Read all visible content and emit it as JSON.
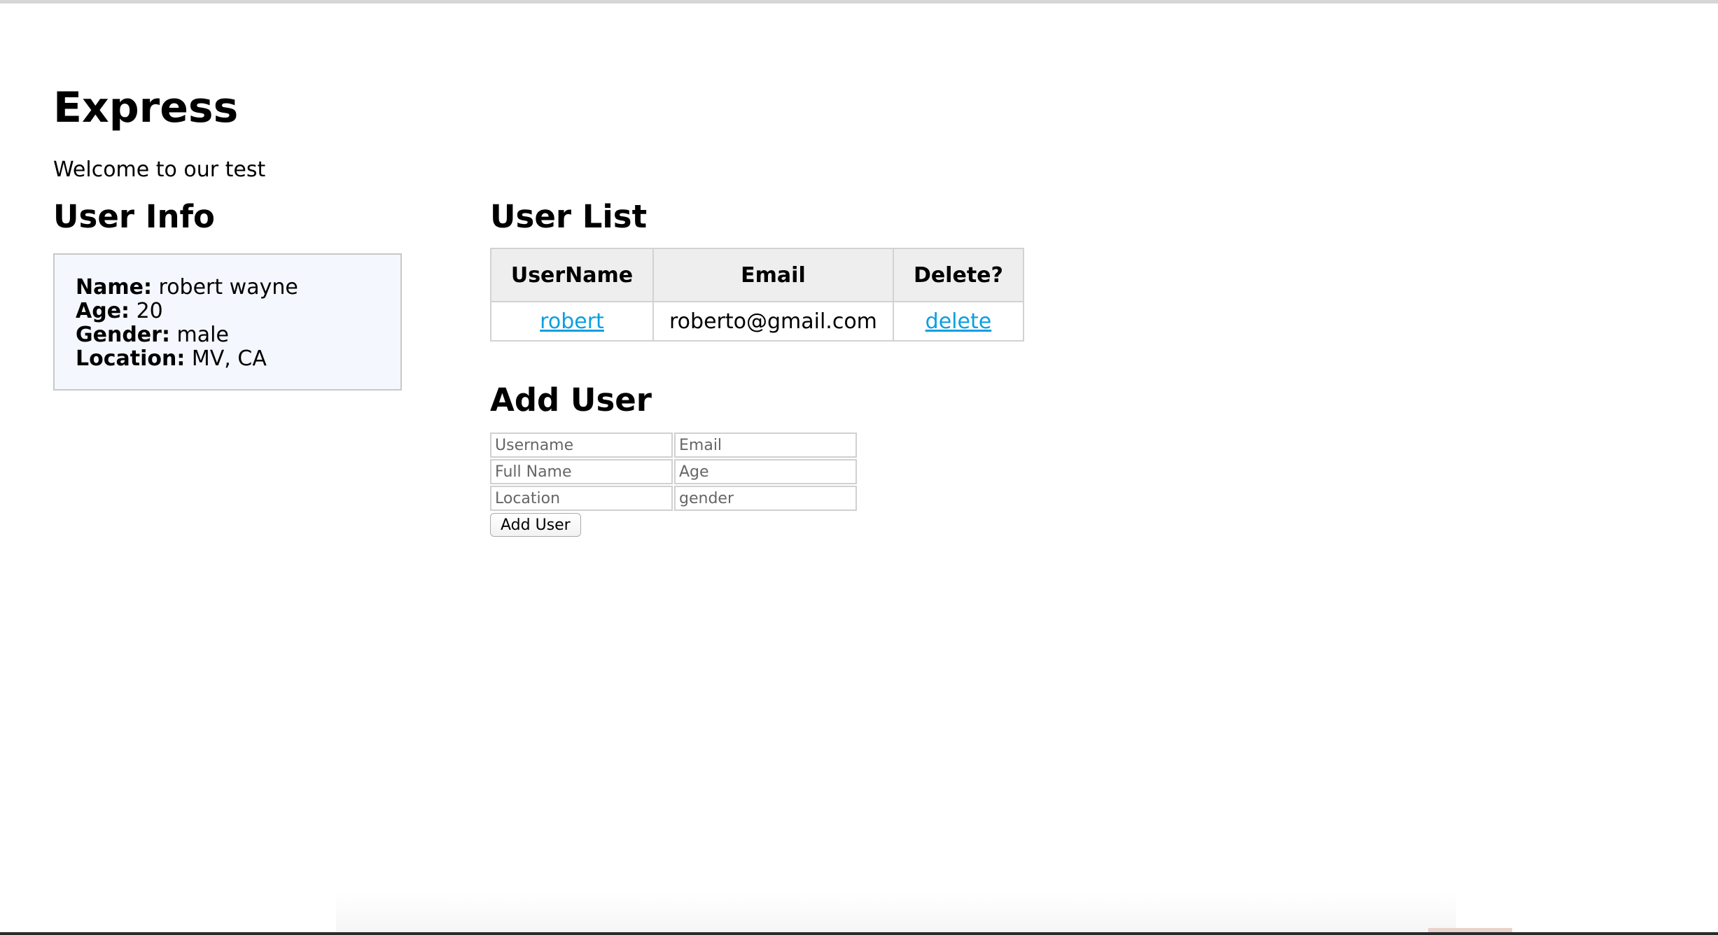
{
  "page": {
    "title": "Express",
    "welcome": "Welcome to our test"
  },
  "user_info": {
    "heading": "User Info",
    "fields": [
      {
        "label": "Name:",
        "value": "robert wayne"
      },
      {
        "label": "Age:",
        "value": "20"
      },
      {
        "label": "Gender:",
        "value": "male"
      },
      {
        "label": "Location:",
        "value": "MV, CA"
      }
    ]
  },
  "user_list": {
    "heading": "User List",
    "columns": [
      "UserName",
      "Email",
      "Delete?"
    ],
    "rows": [
      {
        "username": "robert",
        "email": "roberto@gmail.com",
        "delete_label": "delete"
      }
    ],
    "link_color": "#0b9fe0"
  },
  "add_user": {
    "heading": "Add User",
    "fields": [
      {
        "placeholder": "Username",
        "value": ""
      },
      {
        "placeholder": "Email",
        "value": ""
      },
      {
        "placeholder": "Full Name",
        "value": ""
      },
      {
        "placeholder": "Age",
        "value": ""
      },
      {
        "placeholder": "Location",
        "value": ""
      },
      {
        "placeholder": "gender",
        "value": ""
      }
    ],
    "button_label": "Add User"
  },
  "colors": {
    "info_box_background": "#f4f7fd",
    "table_header_background": "#eeeeee"
  }
}
